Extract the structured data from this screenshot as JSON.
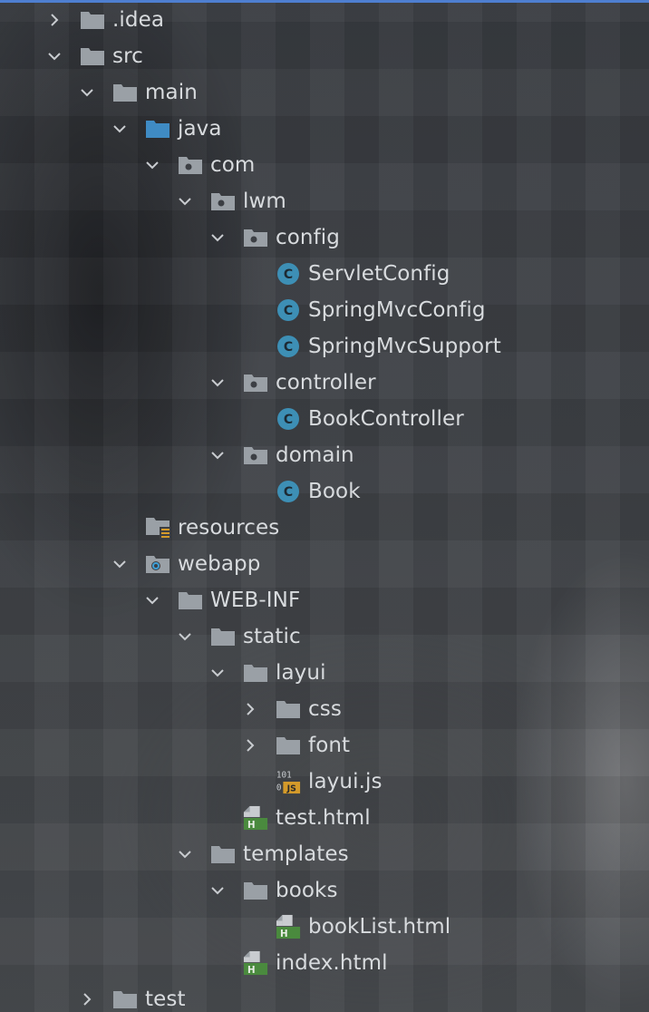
{
  "tree": [
    {
      "label": ".idea",
      "icon": "folder-icon",
      "expanded": false
    },
    {
      "label": "src",
      "icon": "folder-icon",
      "expanded": true
    },
    {
      "label": "main",
      "icon": "folder-icon",
      "expanded": true
    },
    {
      "label": "java",
      "icon": "source-root-folder-icon",
      "expanded": true
    },
    {
      "label": "com",
      "icon": "package-icon",
      "expanded": true
    },
    {
      "label": "lwm",
      "icon": "package-icon",
      "expanded": true
    },
    {
      "label": "config",
      "icon": "package-icon",
      "expanded": true
    },
    {
      "label": "ServletConfig",
      "icon": "java-class-icon"
    },
    {
      "label": "SpringMvcConfig",
      "icon": "java-class-icon"
    },
    {
      "label": "SpringMvcSupport",
      "icon": "java-class-icon"
    },
    {
      "label": "controller",
      "icon": "package-icon",
      "expanded": true
    },
    {
      "label": "BookController",
      "icon": "java-class-icon"
    },
    {
      "label": "domain",
      "icon": "package-icon",
      "expanded": true
    },
    {
      "label": "Book",
      "icon": "java-class-icon"
    },
    {
      "label": "resources",
      "icon": "resources-folder-icon"
    },
    {
      "label": "webapp",
      "icon": "web-folder-icon",
      "expanded": true
    },
    {
      "label": "WEB-INF",
      "icon": "folder-icon",
      "expanded": true
    },
    {
      "label": "static",
      "icon": "folder-icon",
      "expanded": true
    },
    {
      "label": "layui",
      "icon": "folder-icon",
      "expanded": true
    },
    {
      "label": "css",
      "icon": "folder-icon",
      "expanded": false
    },
    {
      "label": "font",
      "icon": "folder-icon",
      "expanded": false
    },
    {
      "label": "layui.js",
      "icon": "javascript-file-icon"
    },
    {
      "label": "test.html",
      "icon": "html-file-icon"
    },
    {
      "label": "templates",
      "icon": "folder-icon",
      "expanded": true
    },
    {
      "label": "books",
      "icon": "folder-icon",
      "expanded": true
    },
    {
      "label": "bookList.html",
      "icon": "html-file-icon"
    },
    {
      "label": "index.html",
      "icon": "html-file-icon"
    },
    {
      "label": "test",
      "icon": "folder-icon",
      "expanded": false
    }
  ],
  "icon_glyphs": {
    "js_badge": "JS",
    "js_binary": "101",
    "html_badge": "H",
    "class_badge": "C"
  },
  "colors": {
    "accent_line": "#4e7fd1",
    "folder": "#9aa0a6",
    "source_root": "#3f8bc4",
    "class_circle": "#3d8fb5",
    "html_green": "#4a8a3e",
    "js_orange": "#d49a2a"
  }
}
